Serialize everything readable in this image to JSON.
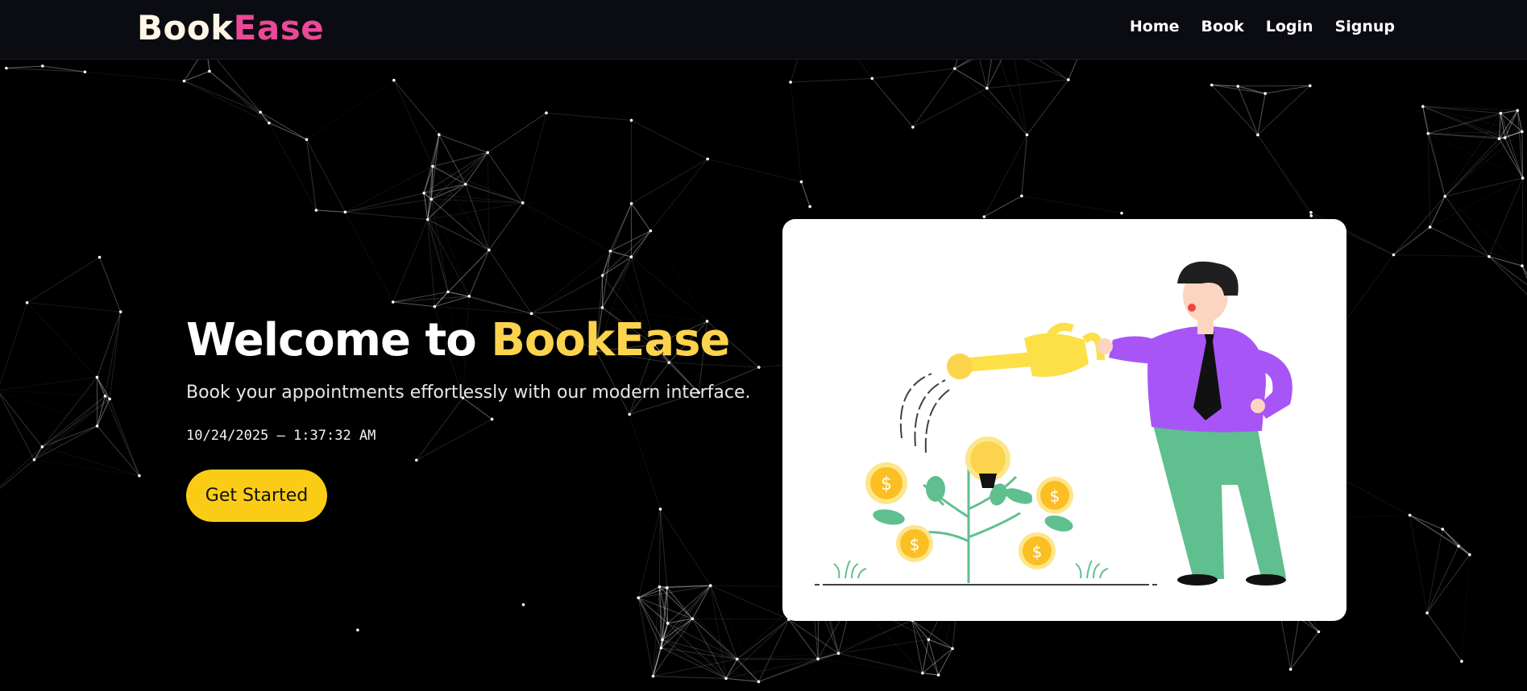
{
  "brand": {
    "part1": "Book",
    "part2": "Ease"
  },
  "nav": {
    "items": [
      "Home",
      "Book",
      "Login",
      "Signup"
    ]
  },
  "hero": {
    "title_prefix": "Welcome to ",
    "title_accent": "BookEase",
    "subtitle": "Book your appointments effortlessly with our modern interface.",
    "datetime": "10/24/2025 – 1:37:32 AM",
    "cta_label": "Get Started"
  },
  "illustration": {
    "name": "man-watering-money-plant-illustration",
    "icons": [
      "watering-can-icon",
      "lightbulb-icon",
      "dollar-coin-icon"
    ]
  },
  "colors": {
    "accent_yellow": "#facc15",
    "brand_pink": "#ec4899",
    "background": "#000000",
    "navbar": "#0b0c12"
  }
}
